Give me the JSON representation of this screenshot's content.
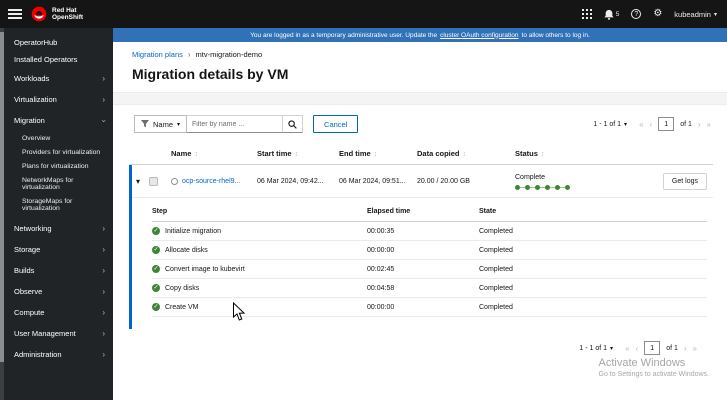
{
  "masthead": {
    "brand_line1": "Red Hat",
    "brand_line2": "OpenShift",
    "notification_count": "5",
    "username": "kubeadmin"
  },
  "banner": {
    "prefix": "You are logged in as a temporary administrative user. Update the",
    "link": "cluster OAuth configuration",
    "suffix": "to allow others to log in."
  },
  "sidebar": {
    "operatorhub": "OperatorHub",
    "installed_operators": "Installed Operators",
    "workloads": "Workloads",
    "virtualization": "Virtualization",
    "migration": "Migration",
    "overview": "Overview",
    "providers": "Providers for virtualization",
    "plans": "Plans for virtualization",
    "networkmaps": "NetworkMaps for virtualization",
    "storagemaps": "StorageMaps for virtualization",
    "networking": "Networking",
    "storage": "Storage",
    "builds": "Builds",
    "observe": "Observe",
    "compute": "Compute",
    "user_management": "User Management",
    "administration": "Administration"
  },
  "breadcrumb": {
    "root": "Migration plans",
    "current": "mtv-migration-demo"
  },
  "page": {
    "title": "Migration details by VM"
  },
  "toolbar": {
    "filter_name": "Name",
    "filter_placeholder": "Filter by name ...",
    "cancel": "Cancel"
  },
  "pagination": {
    "range": "1 - 1 of 1",
    "page": "1",
    "of": "of 1"
  },
  "table": {
    "headers": {
      "name": "Name",
      "start": "Start time",
      "end": "End time",
      "data": "Data copied",
      "status": "Status"
    },
    "row": {
      "name": "ocp-source-rhel9...",
      "start": "06 Mar 2024, 09:42...",
      "end": "06 Mar 2024, 09:51...",
      "data": "20.00 / 20.00 GB",
      "status": "Complete",
      "logs": "Get logs"
    },
    "steps_headers": {
      "step": "Step",
      "elapsed": "Elapsed time",
      "state": "State"
    },
    "steps": [
      {
        "name": "Initialize migration",
        "elapsed": "00:00:35",
        "state": "Completed"
      },
      {
        "name": "Allocate disks",
        "elapsed": "00:00:00",
        "state": "Completed"
      },
      {
        "name": "Convert image to kubevirt",
        "elapsed": "00:02:45",
        "state": "Completed"
      },
      {
        "name": "Copy disks",
        "elapsed": "00:04:58",
        "state": "Completed"
      },
      {
        "name": "Create VM",
        "elapsed": "00:00:00",
        "state": "Completed"
      }
    ]
  },
  "watermark": {
    "line1": "Activate Windows",
    "line2": "Go to Settings to activate Windows."
  },
  "colors": {
    "accent": "#0066cc",
    "success": "#3e8635",
    "banner_bg": "#3171b7",
    "masthead_bg": "#151515",
    "sidebar_bg": "#212427"
  }
}
